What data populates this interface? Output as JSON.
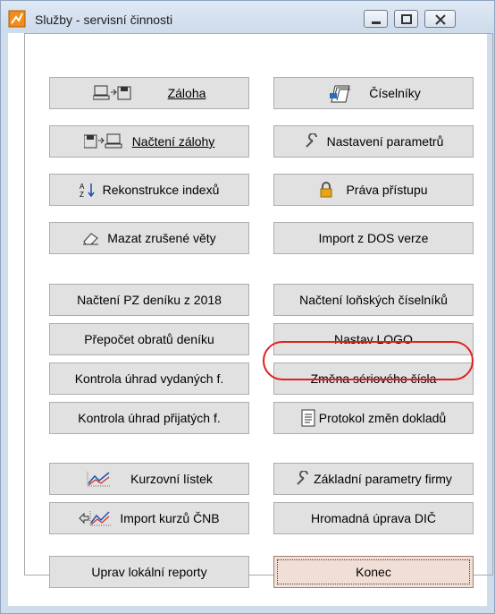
{
  "window": {
    "title": "Služby - servisní činnosti",
    "controls": {
      "minimize": "minimize-icon",
      "maximize": "maximize-icon",
      "close": "close-icon"
    }
  },
  "buttons": {
    "zaloha": "Záloha",
    "ciselniky": "Číselníky",
    "nacteni_zalohy": "Načtení zálohy",
    "nastaveni_parametru": "Nastavení parametrů",
    "rekonstrukce_indexu": "Rekonstrukce indexů",
    "prava_pristupu": "Práva přístupu",
    "mazat_zrusene_vety": "Mazat zrušené věty",
    "import_z_dos": "Import z DOS verze",
    "nacteni_pz_deniku": "Načtení PZ deníku z 2018",
    "nacteni_lonskych_ciselniku": "Načtení loňských číselníků",
    "prepocet_obratu_deniku": "Přepočet obratů deníku",
    "nastav_logo": "Nastav LOGO",
    "kontrola_uhrad_vydanych": "Kontrola úhrad vydaných f.",
    "zmena_seriového_cisla": "Změna sériového čísla",
    "kontrola_uhrad_prijatych": "Kontrola úhrad přijatých f.",
    "protokol_zmen_dokladu": "Protokol změn dokladů",
    "kurzovni_listek": "Kurzovní lístek",
    "zakladni_parametry_firmy": "Základní parametry firmy",
    "import_kurzu_cnb": "Import kurzů ČNB",
    "hromadna_uprava_dic": "Hromadná úprava DIČ",
    "uprav_lokalni_reporty": "Uprav lokální reporty",
    "konec": "Konec"
  },
  "colors": {
    "highlight": "#e02020",
    "window_frame": "#cfdcec",
    "button_face": "#e1e1e1",
    "default_button_face": "#f1ded6"
  }
}
